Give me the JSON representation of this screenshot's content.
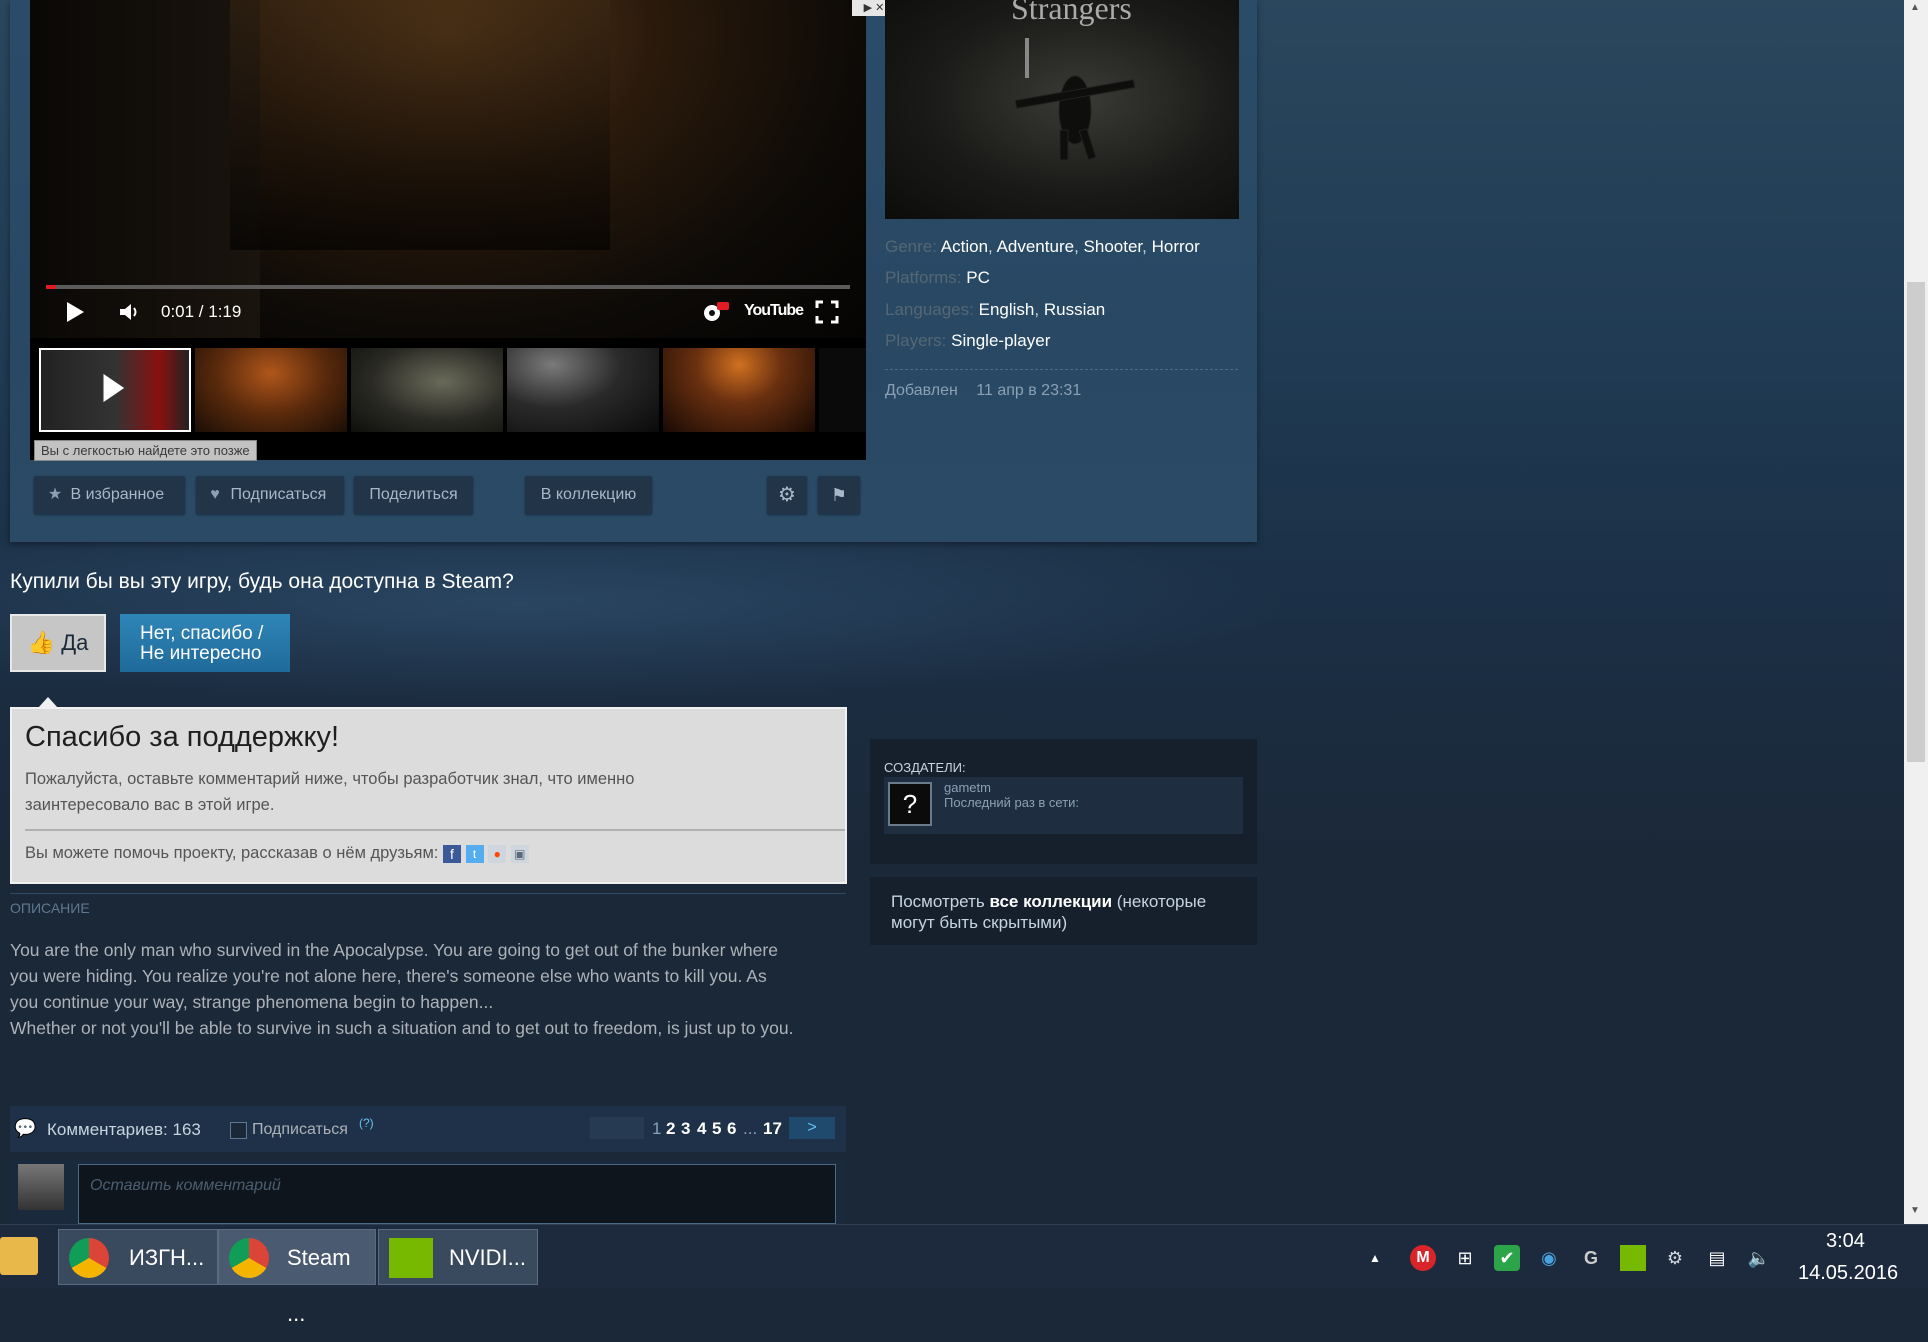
{
  "video": {
    "time": "0:01 / 1:19",
    "progress": 0.013,
    "ad_badge": "▶ ✕",
    "youtube_label": "YouTube"
  },
  "tooltip": "Вы с легкостью найдете это позже",
  "actions": {
    "favorite": "В избранное",
    "subscribe": "Подписаться",
    "share": "Поделиться",
    "collection": "В коллекцию"
  },
  "game": {
    "cover_title": "Strangers",
    "genre_label": "Genre:",
    "genres": [
      "Action",
      "Adventure",
      "Shooter",
      "Horror"
    ],
    "platforms_label": "Platforms:",
    "platforms": "PC",
    "languages_label": "Languages:",
    "languages": [
      "English",
      "Russian"
    ],
    "players_label": "Players:",
    "players": "Single-player",
    "added_label": "Добавлен",
    "added_value": "11 апр в 23:31"
  },
  "vote": {
    "question": "Купили бы вы эту игру, будь она доступна в Steam?",
    "yes": "Да",
    "no_line1": "Нет, спасибо /",
    "no_line2": "Не интересно"
  },
  "thanks": {
    "title": "Спасибо за поддержку!",
    "text_line1": "Пожалуйста, оставьте комментарий ниже, чтобы разработчик знал, что именно",
    "text_line2": "заинтересовало вас в этой игре.",
    "share_text": "Вы можете помочь проекту, рассказав о нём друзьям:"
  },
  "description": {
    "heading": "ОПИСАНИЕ",
    "line1": "You are the only man who survived in the Apocalypse. You are going to get out of the bunker where",
    "line2": "you were hiding. You realize you're not alone here, there's someone else who wants to kill you. As",
    "line3": "you continue your way, strange phenomena begin to happen...",
    "line4": "Whether or not you'll be able to survive in such a situation and to get out to freedom, is just up to you."
  },
  "creators": {
    "heading": "СОЗДАТЕЛИ:",
    "name": "gametm",
    "last_online": "Последний раз в сети:",
    "avatar": "?"
  },
  "collections": {
    "prefix": "Посмотреть ",
    "link": "все коллекции",
    "suffix": " (некоторые",
    "line2": "могут быть скрытыми)"
  },
  "comments": {
    "count_label": "Комментариев: 163",
    "subscribe": "Подписаться",
    "help": "(?)",
    "pages": [
      "1",
      "2",
      "3",
      "4",
      "5",
      "6"
    ],
    "ellipsis": "...",
    "last_page": "17",
    "next": ">",
    "placeholder": "Оставить комментарий"
  },
  "taskbar": {
    "app1": "ИЗГН...",
    "app2": "Steam ...",
    "app3": "NVIDI...",
    "time": "3:04",
    "date": "14.05.2016"
  },
  "colors": {
    "accent": "#2f86b8",
    "progress_red": "#e31b23",
    "page_bg": "#1b2838"
  }
}
